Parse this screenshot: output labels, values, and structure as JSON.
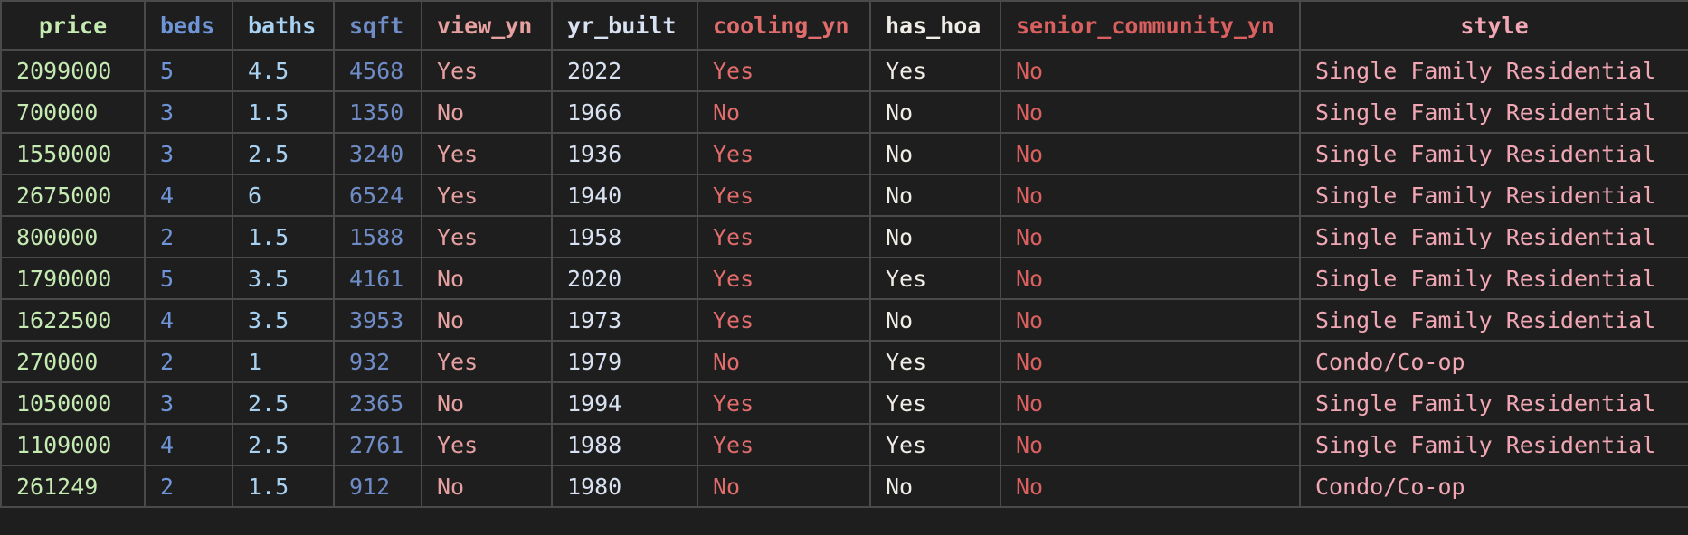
{
  "table": {
    "columns": [
      {
        "label": "price",
        "color": "#c5ebb3"
      },
      {
        "label": "beds",
        "color": "#6f95d8"
      },
      {
        "label": "baths",
        "color": "#a9d2f2"
      },
      {
        "label": "sqft",
        "color": "#6f8cc7"
      },
      {
        "label": "view_yn",
        "color": "#e6a0a0"
      },
      {
        "label": "yr_built",
        "color": "#d9e2f2"
      },
      {
        "label": "cooling_yn",
        "color": "#e06c6c"
      },
      {
        "label": "has_hoa",
        "color": "#f0ece6"
      },
      {
        "label": "senior_community_yn",
        "color": "#d9605f"
      },
      {
        "label": "style",
        "color": "#f2a7b5"
      }
    ],
    "rows": [
      [
        "2099000",
        "5",
        "4.5",
        "4568",
        "Yes",
        "2022",
        "Yes",
        "Yes",
        "No",
        "Single Family Residential"
      ],
      [
        "700000",
        "3",
        "1.5",
        "1350",
        "No",
        "1966",
        "No",
        "No",
        "No",
        "Single Family Residential"
      ],
      [
        "1550000",
        "3",
        "2.5",
        "3240",
        "Yes",
        "1936",
        "Yes",
        "No",
        "No",
        "Single Family Residential"
      ],
      [
        "2675000",
        "4",
        "6",
        "6524",
        "Yes",
        "1940",
        "Yes",
        "No",
        "No",
        "Single Family Residential"
      ],
      [
        "800000",
        "2",
        "1.5",
        "1588",
        "Yes",
        "1958",
        "Yes",
        "No",
        "No",
        "Single Family Residential"
      ],
      [
        "1790000",
        "5",
        "3.5",
        "4161",
        "No",
        "2020",
        "Yes",
        "Yes",
        "No",
        "Single Family Residential"
      ],
      [
        "1622500",
        "4",
        "3.5",
        "3953",
        "No",
        "1973",
        "Yes",
        "No",
        "No",
        "Single Family Residential"
      ],
      [
        "270000",
        "2",
        "1",
        "932",
        "Yes",
        "1979",
        "No",
        "Yes",
        "No",
        "Condo/Co-op"
      ],
      [
        "1050000",
        "3",
        "2.5",
        "2365",
        "No",
        "1994",
        "Yes",
        "Yes",
        "No",
        "Single Family Residential"
      ],
      [
        "1109000",
        "4",
        "2.5",
        "2761",
        "Yes",
        "1988",
        "Yes",
        "Yes",
        "No",
        "Single Family Residential"
      ],
      [
        "261249",
        "2",
        "1.5",
        "912",
        "No",
        "1980",
        "No",
        "No",
        "No",
        "Condo/Co-op"
      ]
    ]
  }
}
